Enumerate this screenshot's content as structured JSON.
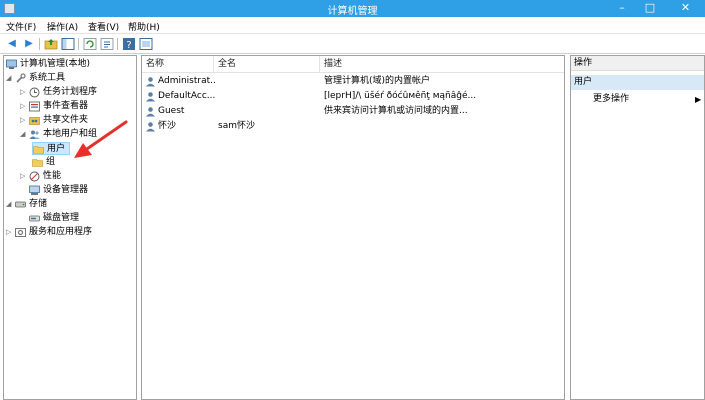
{
  "window": {
    "title": "计算机管理"
  },
  "menu": [
    "文件(F)",
    "操作(A)",
    "查看(V)",
    "帮助(H)"
  ],
  "tree": {
    "root": "计算机管理(本地)",
    "items": [
      {
        "label": "系统工具",
        "depth": 1,
        "expanded": true,
        "icon": "tools-icon"
      },
      {
        "label": "任务计划程序",
        "depth": 2,
        "expanded": false,
        "icon": "clock-icon"
      },
      {
        "label": "事件查看器",
        "depth": 2,
        "expanded": false,
        "icon": "event-viewer-icon"
      },
      {
        "label": "共享文件夹",
        "depth": 2,
        "expanded": false,
        "icon": "shared-folder-icon"
      },
      {
        "label": "本地用户和组",
        "depth": 2,
        "expanded": true,
        "icon": "users-icon"
      },
      {
        "label": "用户",
        "depth": 3,
        "selected": true,
        "icon": "folder-icon"
      },
      {
        "label": "组",
        "depth": 3,
        "icon": "folder-icon"
      },
      {
        "label": "性能",
        "depth": 2,
        "expanded": false,
        "icon": "performance-icon"
      },
      {
        "label": "设备管理器",
        "depth": 2,
        "icon": "device-manager-icon"
      },
      {
        "label": "存储",
        "depth": 1,
        "expanded": true,
        "icon": "storage-icon"
      },
      {
        "label": "磁盘管理",
        "depth": 2,
        "icon": "disk-icon"
      },
      {
        "label": "服务和应用程序",
        "depth": 1,
        "expanded": false,
        "icon": "services-icon"
      }
    ]
  },
  "list": {
    "columns": [
      "名称",
      "全名",
      "描述"
    ],
    "rows": [
      {
        "name": "Administrat...",
        "fullname": "",
        "desc": "管理计算机(域)的内置帐户"
      },
      {
        "name": "DefaultAcc...",
        "fullname": "",
        "desc": "[leprH]/\\ üšéŕ ðóćûмêñţ мąñâĝé..."
      },
      {
        "name": "Guest",
        "fullname": "",
        "desc": "供来宾访问计算机或访问域的内置..."
      },
      {
        "name": "怀沙",
        "fullname": "sam怀沙",
        "desc": ""
      }
    ]
  },
  "actions": {
    "header": "操作",
    "section": "用户",
    "items": [
      "更多操作"
    ]
  },
  "colors": {
    "titlebar": "#2f9fe6",
    "selection": "#cce8ff",
    "annotation_arrow": "#e8302a"
  }
}
